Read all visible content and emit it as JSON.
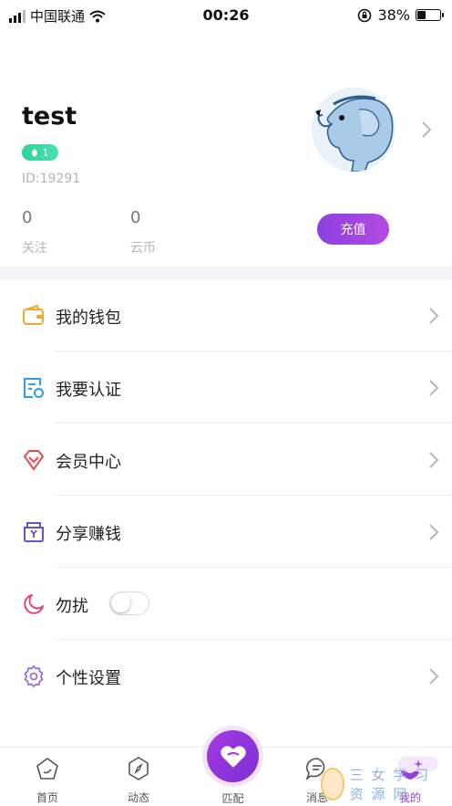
{
  "status_bar": {
    "carrier": "中国联通",
    "time": "00:26",
    "battery": "38%",
    "battery_level": 0.38
  },
  "profile": {
    "username": "test",
    "level": "1",
    "user_id": "ID:19291",
    "stats": [
      {
        "value": "0",
        "label": "关注"
      },
      {
        "value": "0",
        "label": "云币"
      }
    ],
    "recharge_label": "充值"
  },
  "menu": {
    "items": [
      {
        "label": "我的钱包",
        "icon": "wallet-icon",
        "color": "#f0a834"
      },
      {
        "label": "我要认证",
        "icon": "certification-icon",
        "color": "#2a9ee6"
      },
      {
        "label": "会员中心",
        "icon": "diamond-icon",
        "color": "#e24d4d"
      },
      {
        "label": "分享赚钱",
        "icon": "share-earn-icon",
        "color": "#6c52c9"
      },
      {
        "label": "勿扰",
        "icon": "moon-icon",
        "color": "#e0457c",
        "toggle_on": false
      },
      {
        "label": "个性设置",
        "icon": "settings-gear-icon",
        "color": "#9b6fd6"
      }
    ]
  },
  "tabbar": {
    "tabs": [
      {
        "label": "首页",
        "icon": "home-icon"
      },
      {
        "label": "动态",
        "icon": "compass-icon"
      },
      {
        "label": "匹配",
        "icon": "heart-match-icon"
      },
      {
        "label": "消息",
        "icon": "message-icon"
      },
      {
        "label": "我的",
        "icon": "profile-icon"
      }
    ]
  },
  "watermark": {
    "text": "三 女 学 习 资 源 网"
  },
  "colors": {
    "accent_purple": "#9a3de0",
    "level_green": "#2fd39a",
    "muted_text": "#b5b5b5"
  }
}
